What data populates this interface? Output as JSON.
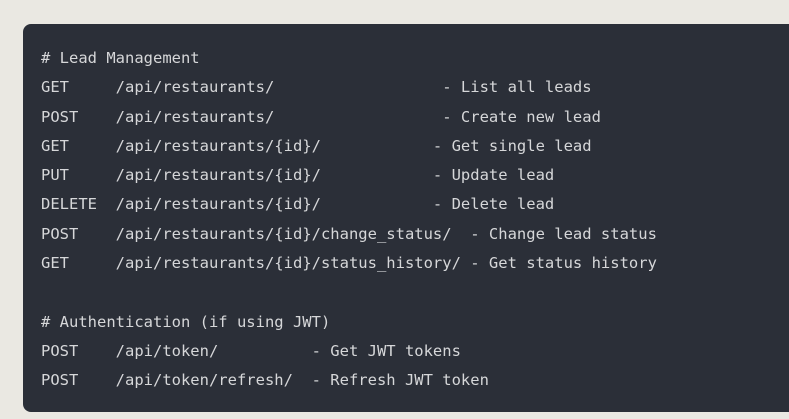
{
  "code_block": {
    "lines": [
      "# Lead Management",
      "GET     /api/restaurants/                  - List all leads",
      "POST    /api/restaurants/                  - Create new lead",
      "GET     /api/restaurants/{id}/            - Get single lead",
      "PUT     /api/restaurants/{id}/            - Update lead",
      "DELETE  /api/restaurants/{id}/            - Delete lead",
      "POST    /api/restaurants/{id}/change_status/  - Change lead status",
      "GET     /api/restaurants/{id}/status_history/ - Get status history",
      "",
      "# Authentication (if using JWT)",
      "POST    /api/token/          - Get JWT tokens",
      "POST    /api/token/refresh/  - Refresh JWT token"
    ]
  }
}
